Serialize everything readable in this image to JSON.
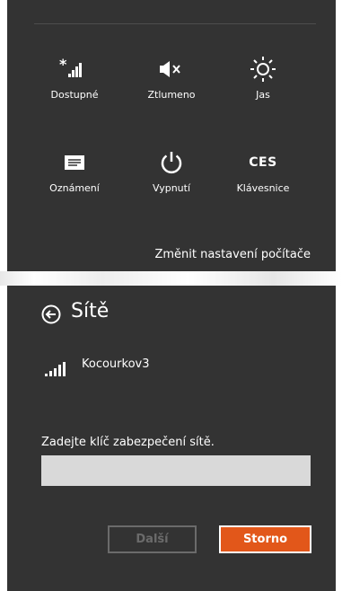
{
  "quick_settings": {
    "tiles": [
      {
        "label": "Dostupné",
        "icon": "wifi-available-icon"
      },
      {
        "label": "Ztlumeno",
        "icon": "speaker-muted-icon"
      },
      {
        "label": "Jas",
        "icon": "brightness-icon"
      },
      {
        "label": "Oznámení",
        "icon": "notifications-icon"
      },
      {
        "label": "Vypnutí",
        "icon": "power-icon"
      },
      {
        "label": "Klávesnice",
        "icon": "keyboard-language-icon",
        "icon_text": "CES"
      }
    ],
    "change_settings_link": "Změnit nastavení počítače"
  },
  "networks": {
    "title": "Sítě",
    "back_icon": "back-arrow-icon",
    "selected_network": {
      "name": "Kocourkov3",
      "icon": "wifi-signal-icon"
    },
    "security_key": {
      "label": "Zadejte klíč zabezpečení sítě.",
      "value": "",
      "placeholder": ""
    },
    "buttons": {
      "next_label": "Další",
      "cancel_label": "Storno"
    }
  },
  "colors": {
    "panel_background": "#333333",
    "accent_orange": "#e2571a",
    "text": "#ffffff",
    "disabled": "#6b6b6b",
    "input_background": "#d9d9d9"
  }
}
